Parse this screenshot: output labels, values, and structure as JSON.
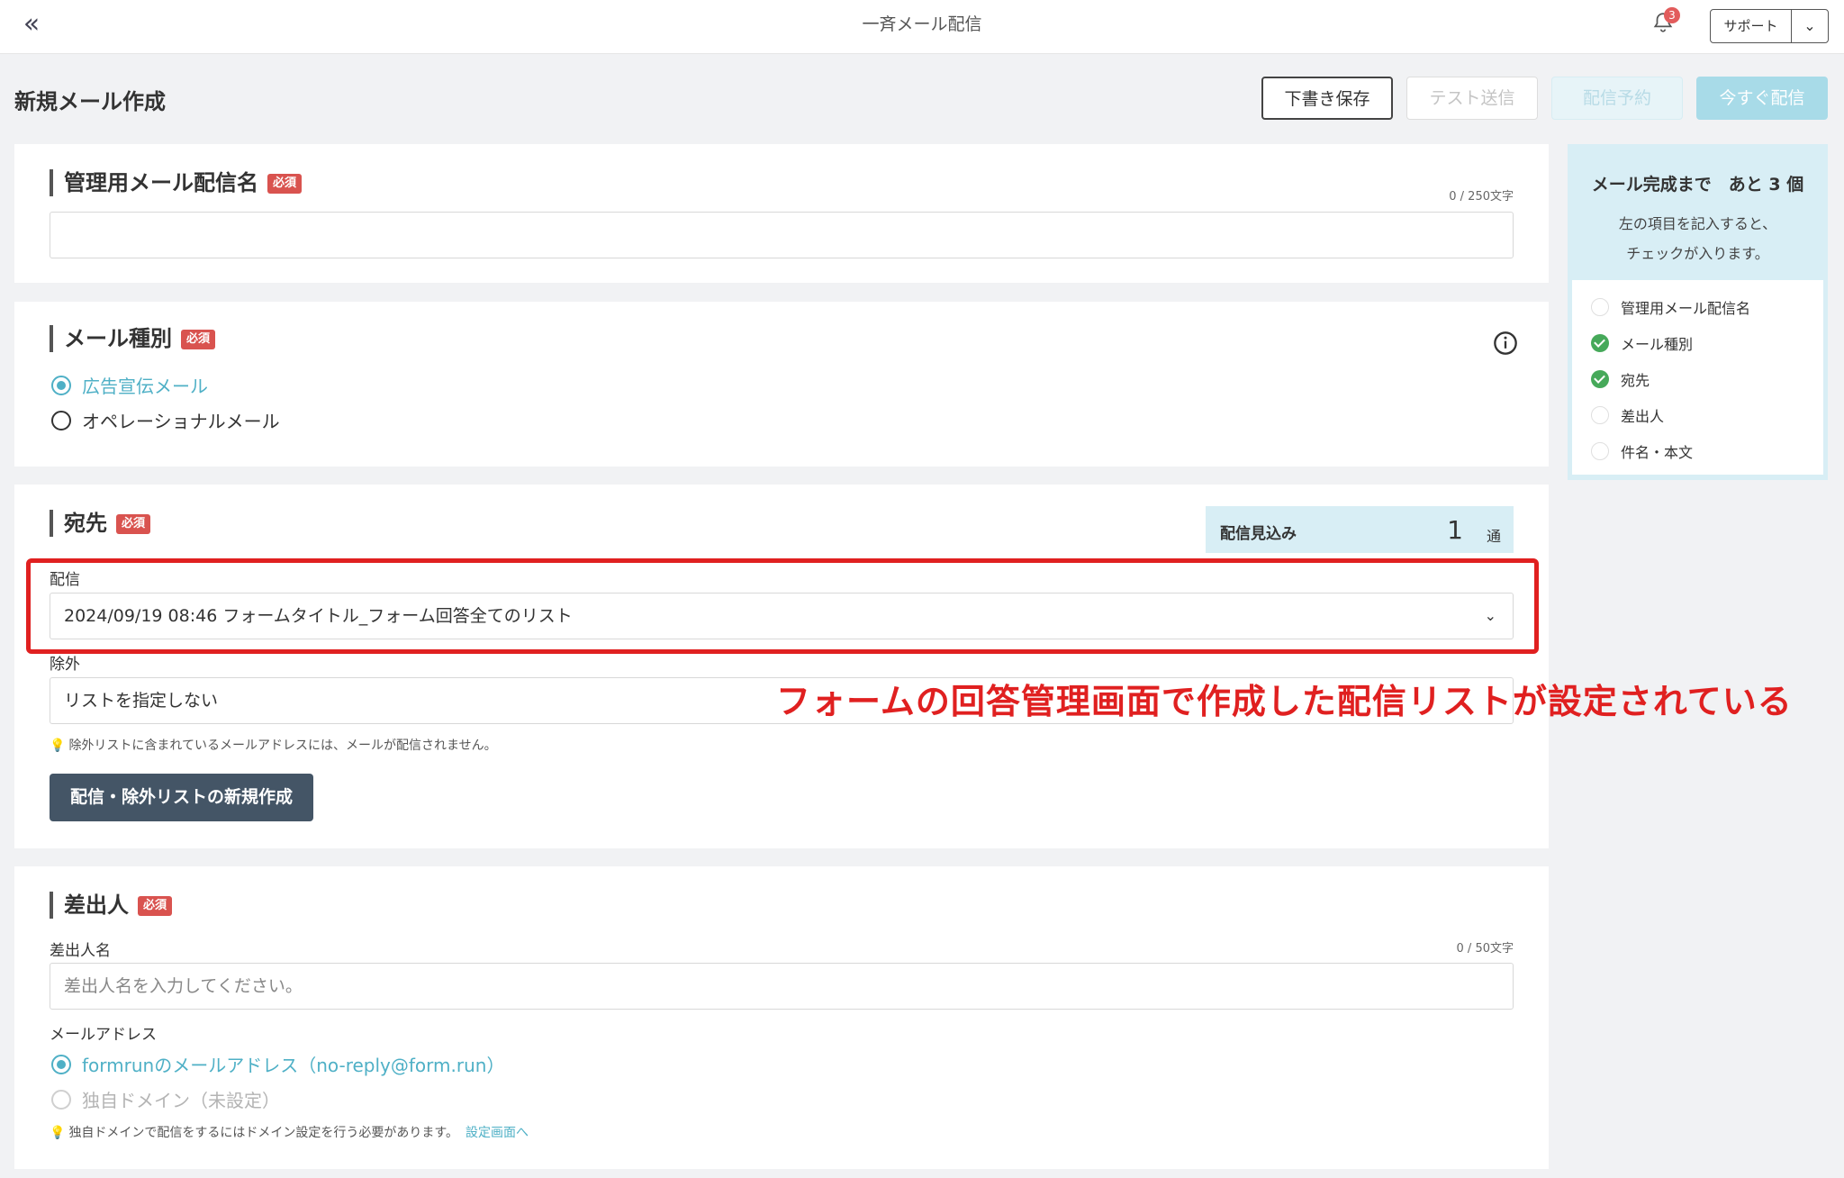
{
  "topbar": {
    "back_icon": "double-chevron-left-icon",
    "title": "一斉メール配信",
    "notification_count": "3",
    "support_label": "サポート"
  },
  "page": {
    "title": "新規メール作成",
    "actions": {
      "draft": "下書き保存",
      "test": "テスト送信",
      "schedule": "配信予約",
      "send_now": "今すぐ配信"
    }
  },
  "required_label": "必須",
  "section_name": {
    "heading": "管理用メール配信名",
    "char_count": "0 / 250文字",
    "value": ""
  },
  "section_type": {
    "heading": "メール種別",
    "options": [
      {
        "label": "広告宣伝メール",
        "selected": true
      },
      {
        "label": "オペレーショナルメール",
        "selected": false
      }
    ]
  },
  "section_recipient": {
    "heading": "宛先",
    "estimate_label": "配信見込み",
    "estimate_count": "1",
    "estimate_unit": "通",
    "delivery_label": "配信",
    "delivery_value": "2024/09/19 08:46 フォームタイトル_フォーム回答全てのリスト",
    "exclude_label": "除外",
    "exclude_value": "リストを指定しない",
    "hint": "除外リストに含まれているメールアドレスには、メールが配信されません。",
    "create_button": "配信・除外リストの新規作成"
  },
  "annotation": "フォームの回答管理画面で作成した配信リストが設定されている",
  "section_sender": {
    "heading": "差出人",
    "name_label": "差出人名",
    "char_count": "0 / 50文字",
    "name_placeholder": "差出人名を入力してください。",
    "email_label": "メールアドレス",
    "email_options": [
      {
        "label": "formrunのメールアドレス（no-reply@form.run）",
        "selected": true
      },
      {
        "label": "独自ドメイン（未設定）",
        "selected": false,
        "disabled": true
      }
    ],
    "hint": "独自ドメインで配信をするにはドメイン設定を行う必要があります。",
    "hint_link": "設定画面へ"
  },
  "side_panel": {
    "title": "メール完成まで　あと 3 個",
    "subtitle_line1": "左の項目を記入すると、",
    "subtitle_line2": "チェックが入ります。",
    "items": [
      {
        "label": "管理用メール配信名",
        "done": false
      },
      {
        "label": "メール種別",
        "done": true
      },
      {
        "label": "宛先",
        "done": true
      },
      {
        "label": "差出人",
        "done": false
      },
      {
        "label": "件名・本文",
        "done": false
      }
    ]
  },
  "colors": {
    "accent": "#4fb0c6",
    "required": "#d9534f",
    "annotation": "#e02020",
    "check_done": "#46a95a"
  }
}
